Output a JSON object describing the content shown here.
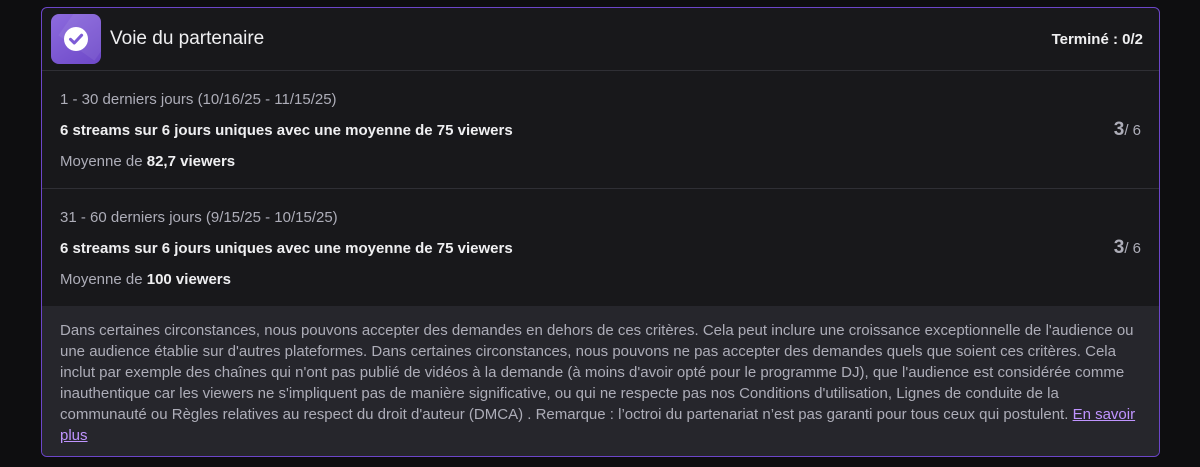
{
  "header": {
    "title": "Voie du partenaire",
    "status": "Terminé : 0/2",
    "badge_icon": "check-icon",
    "accent": "#7d5bd6"
  },
  "periods": [
    {
      "range": "1 - 30 derniers jours (10/16/25 - 11/15/25)",
      "requirement": "6 streams sur 6 jours uniques avec une moyenne de 75 viewers",
      "average_prefix": "Moyenne de",
      "average_value": "82,7 viewers",
      "count_value": "3",
      "count_total": "/ 6"
    },
    {
      "range": "31 - 60 derniers jours (9/15/25 - 10/15/25)",
      "requirement": "6 streams sur 6 jours uniques avec une moyenne de 75 viewers",
      "average_prefix": "Moyenne de",
      "average_value": "100 viewers",
      "count_value": "3",
      "count_total": "/ 6"
    }
  ],
  "note": {
    "text": "Dans certaines circonstances, nous pouvons accepter des demandes en dehors de ces critères. Cela peut inclure une croissance exceptionnelle de l'audience ou une audience établie sur d'autres plateformes. Dans certaines circonstances, nous pouvons ne pas accepter des demandes quels que soient ces critères. Cela inclut par exemple des chaînes qui n'ont pas publié de vidéos à la demande (à moins d'avoir opté pour le programme DJ), que l'audience est considérée comme inauthentique car les viewers ne s'impliquent pas de manière significative, ou qui ne respecte pas nos Conditions d'utilisation, Lignes de conduite de la communauté ou Règles relatives au respect du droit d'auteur (DMCA) . Remarque : l’octroi du partenariat n’est pas garanti pour tous ceux qui postulent.",
    "link_label": "En savoir plus"
  }
}
